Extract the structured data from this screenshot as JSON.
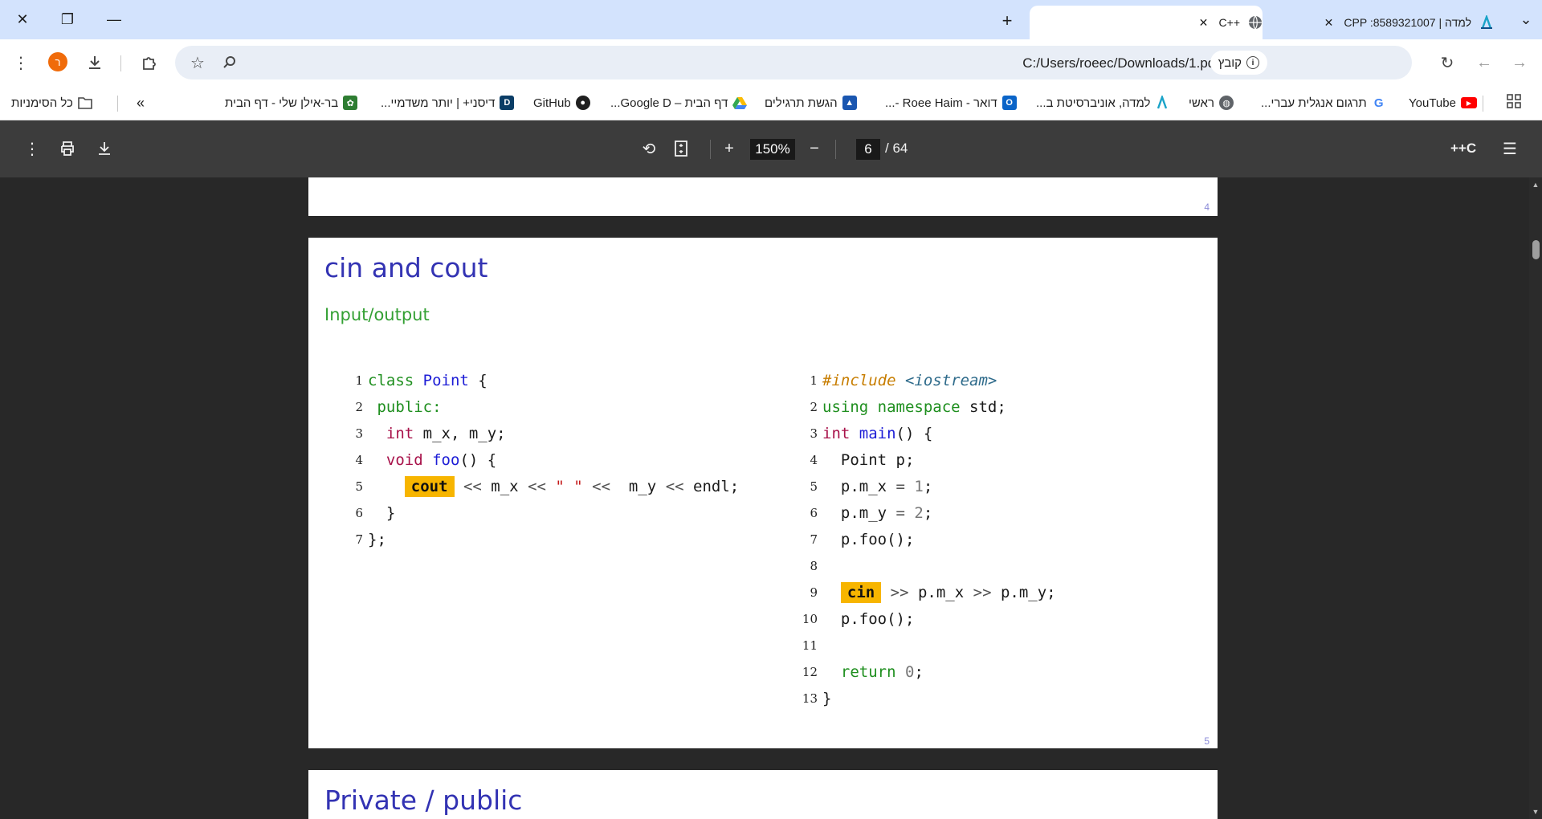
{
  "tabs": [
    {
      "title": "למדה | CPP :8589321007",
      "active": false
    },
    {
      "title": "C++",
      "active": true
    }
  ],
  "toolbar": {
    "url": "C:/Users/roeec/Downloads/1.pdf",
    "chip_label": "קובץ",
    "avatar_letter": "ר"
  },
  "bookmarks": {
    "items": [
      {
        "label": "YouTube",
        "icon": "youtube-icon",
        "color": "#ff0000"
      },
      {
        "label": "תרגום אנגלית עברי...",
        "icon": "google-icon",
        "color": "#4285f4"
      },
      {
        "label": "ראשי",
        "icon": "globe-icon",
        "color": "#5f6368"
      },
      {
        "label": "למדה, אוניברסיטת ב...",
        "icon": "lamda-icon",
        "color": "#1aa3c8"
      },
      {
        "label": "דואר - Roee Haim -...",
        "icon": "outlook-icon",
        "color": "#0a64c8"
      },
      {
        "label": "הגשת תרגילים",
        "icon": "submit-icon",
        "color": "#1a56b0"
      },
      {
        "label": "דף הבית – Google D...",
        "icon": "drive-icon",
        "color": "#34a853"
      },
      {
        "label": "GitHub",
        "icon": "github-icon",
        "color": "#1f1f1f"
      },
      {
        "label": "דיסני+ | יותר משדמיי...",
        "icon": "disney-icon",
        "color": "#0b3d66"
      },
      {
        "label": "בר-אילן שלי - דף הבית",
        "icon": "biu-icon",
        "color": "#2e7d32"
      }
    ],
    "all_bookmarks": "כל הסימניות",
    "more": "»"
  },
  "pdf_toolbar": {
    "title": "C++",
    "zoom": "150%",
    "page_current": "6",
    "page_total": "/ 64"
  },
  "pages": {
    "prev_page_number": "4",
    "current_page_number": "5",
    "slide_title": "cin and cout",
    "slide_subtitle": "Input/output",
    "next_slide_title": "Private / public"
  },
  "code_left": {
    "line_numbers": [
      "1",
      "2",
      "3",
      "4",
      "5",
      "6",
      "7"
    ],
    "l1_kw": "class",
    "l1_name": "Point",
    "l1_rest": " {",
    "l2_kw": "public:",
    "l3_type": "int",
    "l3_rest": " m_x, m_y;",
    "l4_type": "void",
    "l4_fn": "foo",
    "l4_rest": "() {",
    "l5_hl": "cout",
    "l5_op1": " << ",
    "l5_a": "m_x",
    "l5_op2": " << ",
    "l5_str": "\" \"",
    "l5_op3": " <<  ",
    "l5_b": "m_y",
    "l5_op4": " << ",
    "l5_c": "endl;",
    "l6": "}",
    "l7": "};"
  },
  "code_right": {
    "line_numbers": [
      "1",
      "2",
      "3",
      "4",
      "5",
      "6",
      "7",
      "8",
      "9",
      "10",
      "11",
      "12",
      "13"
    ],
    "l1_pre": "#include",
    "l1_inc": "<iostream>",
    "l2_kw1": "using",
    "l2_kw2": "namespace",
    "l2_rest": " std;",
    "l3_type": "int",
    "l3_fn": "main",
    "l3_rest": "() {",
    "l4": "Point p;",
    "l5_a": "p.m_x",
    "l5_op": " = ",
    "l5_num": "1",
    "l5_end": ";",
    "l6_a": "p.m_y",
    "l6_op": " = ",
    "l6_num": "2",
    "l6_end": ";",
    "l7": "p.foo();",
    "l9_hl": "cin",
    "l9_op1": " >> ",
    "l9_a": "p.m_x",
    "l9_op2": " >> ",
    "l9_b": "p.m_y;",
    "l10": "p.foo();",
    "l12_kw": "return",
    "l12_num": "0",
    "l12_end": ";",
    "l13": "}"
  }
}
